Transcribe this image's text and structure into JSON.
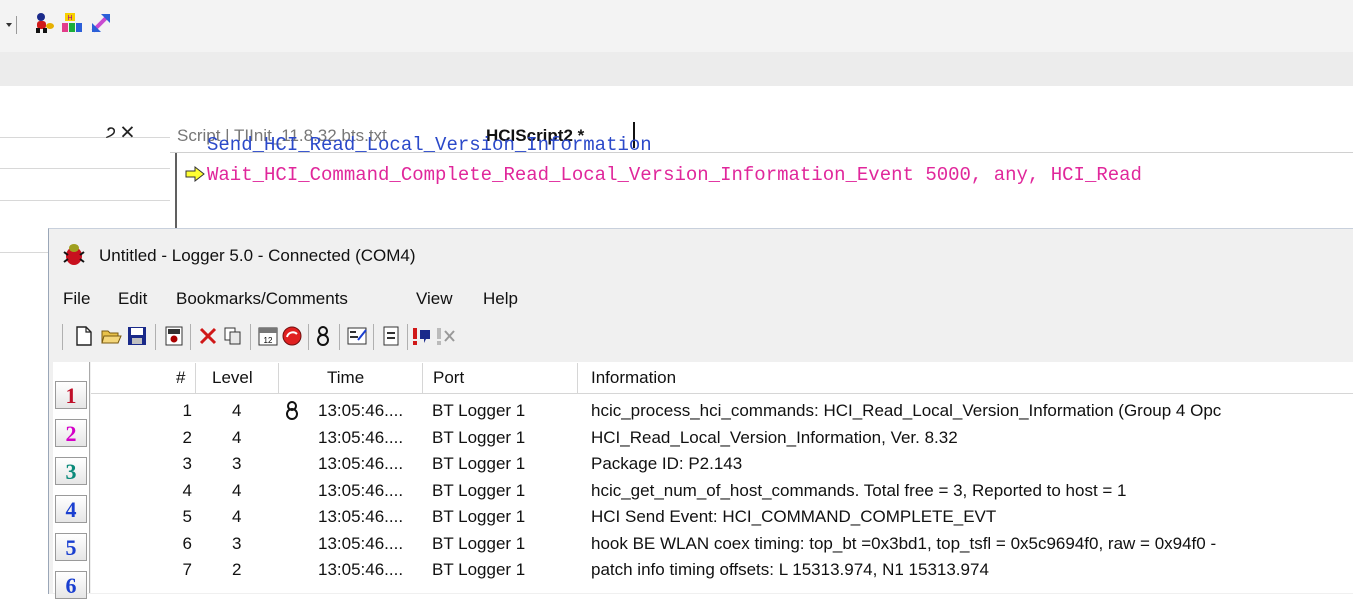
{
  "toolbar": {
    "icons": [
      "dropdown-arrow-icon",
      "bug-person-icon",
      "hci-blocks-icon",
      "diagonal-arrow-icon"
    ]
  },
  "left_panel": {
    "pin_label": "੭",
    "close_label": "✕"
  },
  "script_editor": {
    "tabs": [
      {
        "label": "Script | TIInit_11.8.32.bts.txt",
        "active": false
      },
      {
        "label": "HCIScript2 *",
        "active": true
      }
    ],
    "lines": [
      {
        "text": "Send_HCI_Read_Local_Version_Information",
        "color": "#2b49c9"
      },
      {
        "text": "Wait_HCI_Command_Complete_Read_Local_Version_Information_Event 5000, any, HCI_Read",
        "color": "#e0279b"
      }
    ]
  },
  "logger": {
    "title": "Untitled - Logger 5.0 - Connected  (COM4)",
    "menu": [
      "File",
      "Edit",
      "Bookmarks/Comments",
      "View",
      "Help"
    ],
    "toolbar_icons": [
      "new-file-icon",
      "open-folder-icon",
      "save-icon",
      "lock-icon",
      "delete-icon",
      "copy-icon",
      "calendar-icon",
      "record-icon",
      "bookmark-icon",
      "properties-icon",
      "filter-icon",
      "alert-icon",
      "alert-clear-icon"
    ],
    "bookmarks": [
      {
        "label": "1",
        "color": "#c0102a"
      },
      {
        "label": "2",
        "color": "#d400c8"
      },
      {
        "label": "3",
        "color": "#0a8a7a"
      },
      {
        "label": "4",
        "color": "#1a3fd0"
      },
      {
        "label": "5",
        "color": "#1a3fd0"
      },
      {
        "label": "6",
        "color": "#1a3fd0"
      }
    ],
    "columns": [
      "#",
      "Level",
      "Time",
      "Port",
      "Information"
    ],
    "rows": [
      {
        "num": "1",
        "level": "4",
        "time": "13:05:46....",
        "port": "BT Logger 1",
        "info": "hcic_process_hci_commands: HCI_Read_Local_Version_Information (Group 4 Opc",
        "icon": true
      },
      {
        "num": "2",
        "level": "4",
        "time": "13:05:46....",
        "port": "BT Logger 1",
        "info": "HCI_Read_Local_Version_Information, Ver. 8.32",
        "icon": false
      },
      {
        "num": "3",
        "level": "3",
        "time": "13:05:46....",
        "port": "BT Logger 1",
        "info": "Package ID: P2.143",
        "icon": false
      },
      {
        "num": "4",
        "level": "4",
        "time": "13:05:46....",
        "port": "BT Logger 1",
        "info": "hcic_get_num_of_host_commands. Total free = 3, Reported to host = 1",
        "icon": false
      },
      {
        "num": "5",
        "level": "4",
        "time": "13:05:46....",
        "port": "BT Logger 1",
        "info": "HCI Send Event: HCI_COMMAND_COMPLETE_EVT",
        "icon": false
      },
      {
        "num": "6",
        "level": "3",
        "time": "13:05:46....",
        "port": "BT Logger 1",
        "info": "hook BE WLAN coex timing: top_bt =0x3bd1, top_tsfl = 0x5c9694f0, raw = 0x94f0 -",
        "icon": false
      },
      {
        "num": "7",
        "level": "2",
        "time": "13:05:46....",
        "port": "BT Logger 1",
        "info": "patch info timing offsets: L 15313.974, N1 15313.974",
        "icon": false
      }
    ]
  }
}
